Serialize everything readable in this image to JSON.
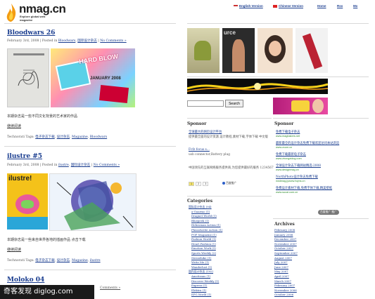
{
  "header": {
    "logo_text": "nmag.cn",
    "tagline": "Explore global web magazine",
    "nav": [
      "English Version",
      "Chinese Version",
      "Home",
      "Rss",
      "Mx"
    ]
  },
  "posts": [
    {
      "title": "Bloodwars 26",
      "meta_date": "February 3rd, 2008 | Posted in ",
      "meta_cat1": "Bloodwars",
      "meta_cat2": "国际设计杂志",
      "meta_comments": "No Comments »",
      "cover_label": "HARD BLOW",
      "cover_sub": "JANUARY 2008",
      "body": "本期杂志是一些不同文化背景的艺术家的作品",
      "more": "继续阅读",
      "tags_label": "Technorati Tags: ",
      "tags": [
        "电子杂志下载",
        "设计杂志",
        "Magazine",
        "Bloodwars"
      ]
    },
    {
      "title": "ilustre #5",
      "meta_date": "February 3rd, 2008 | Posted in ",
      "meta_cat1": "ilustre",
      "meta_cat2": "国际设计杂志",
      "meta_comments": "No Comments »",
      "cover_label": "ilustre!",
      "body": "本期杂志是一些来自世界各地的插画作品 点击下载",
      "more": "继续阅读",
      "tags_label": "Technorati Tags: ",
      "tags": [
        "电子杂志下载",
        "设计杂志",
        "Magazine",
        "ilustre"
      ]
    },
    {
      "title": "Moloko 04",
      "meta_comments": "Comments »"
    }
  ],
  "sidebar": {
    "search_button": "Search",
    "sponsor_left": {
      "heading": "Sponsor",
      "items": [
        {
          "title": "全球最大的网页设计平台",
          "desc": "提供最全面的设计资源,设计教程,素材下载,字体下载 中文版"
        },
        {
          "title": "Fcfz focus s...",
          "desc": "usb connector,Battery plug"
        },
        {
          "title": "",
          "desc": "中国领先的互联网络服务提供商,为您提供最好的服务 1234567"
        }
      ],
      "pager": [
        "1",
        "2",
        "3"
      ],
      "ads_label": "百度推广"
    },
    "sponsor_right": {
      "heading": "Sponsor",
      "items": [
        {
          "title": "免费下载电子杂志",
          "url": "www.magbakers.net"
        },
        {
          "title": "最新最全的设计杂志免费下载欢迎访问本站浏览",
          "url": "www.zcom.cn"
        },
        {
          "title": "免费下载最新电子杂志",
          "url": "www.zhongzidog.com"
        },
        {
          "title": "全球设计杂志下载网站精选-2008",
          "url": "www.designmag.cn"
        },
        {
          "title": "NorthPhoto设计杂志免费下载",
          "url": "nwdmag.jywww.hqms.cn"
        },
        {
          "title": "免费设计素材下载,免费字体下载,精美壁纸",
          "url": "www.sucai.com.cn"
        }
      ],
      "badge": "百度推广 推广"
    },
    "categories": {
      "heading": "Categories",
      "items": [
        "国际设计杂志 (94)",
        "a-Guarmo (1)",
        "Dragnet World (1)",
        "Bluepeek (1)",
        "Hehroman Action (1)",
        "Pheastwrite Action (1)",
        "POP Magazine (1)",
        "Fashion World (1)",
        "Heart Fashion (1)",
        "Emotion Work (5)",
        "Sports Weekly (2)",
        "Steezehike (1)",
        "Write Me (1)",
        "Wanderlust (1)",
        "国内设计杂志 (192)",
        "Amsttrans (1)",
        "Discover Weekly (1)",
        "Express (1)",
        "Elektra (1)",
        "EPG World (1)"
      ]
    },
    "archives": {
      "heading": "Archives",
      "items": [
        "February 2008",
        "January 2008",
        "December 2007",
        "November 2007",
        "October 2007",
        "September 2007",
        "August 2007",
        "July 2007",
        "June 2007",
        "May 2007",
        "April 2007",
        "March 2007",
        "February 2007",
        "November 2006",
        "October 2006"
      ]
    }
  },
  "watermark": "奇客发现 diglog.com",
  "colors": {
    "link": "#1a3d8f",
    "green": "#2e8b2e",
    "logo_orange": "#f39c12"
  }
}
